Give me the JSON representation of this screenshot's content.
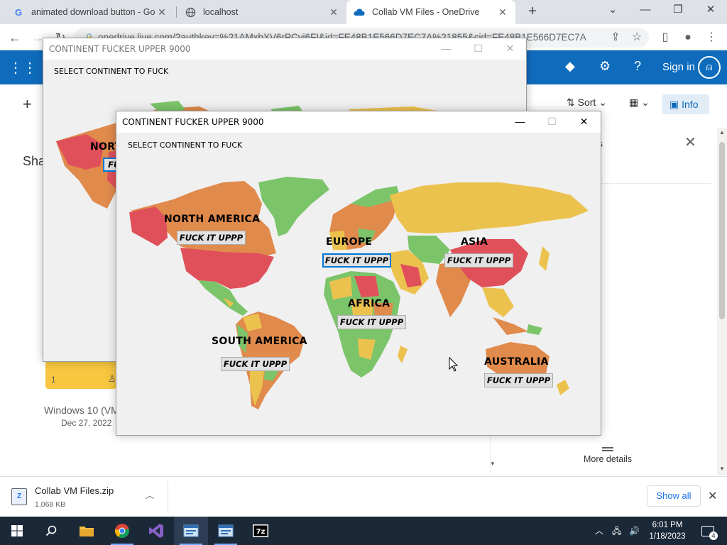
{
  "browser": {
    "tabs": [
      {
        "title": "animated download button - Go",
        "icon": "google-g-icon",
        "active": false
      },
      {
        "title": "localhost",
        "icon": "globe-icon",
        "active": false
      },
      {
        "title": "Collab VM Files - OneDrive",
        "icon": "onedrive-cloud-icon",
        "active": true
      }
    ],
    "url": "onedrive.live.com/?authkey=%21AMxbXV6rPCvi6FI&id=FE48B1E566D7EC7A%21855&cid=FE48B1E566D7EC7A"
  },
  "onedrive": {
    "signin_label": "Sign in",
    "sort_label": "Sort",
    "info_label": "Info",
    "partial_heading": "Sha",
    "partial_pane_text": "s",
    "file_name": "Windows 10 (VM",
    "file_date": "Dec 27, 2022",
    "tile_count": "1",
    "more_details": "More details"
  },
  "app_window": {
    "title": "CONTINENT FUCKER UPPER 9000",
    "prompt": "SELECT CONTINENT TO FUCK",
    "button_label": "FUCK IT UPPP",
    "continents": [
      {
        "name": "NORTH AMERICA"
      },
      {
        "name": "EUROPE",
        "focused": true
      },
      {
        "name": "ASIA"
      },
      {
        "name": "AFRICA"
      },
      {
        "name": "SOUTH AMERICA"
      },
      {
        "name": "AUSTRALIA"
      }
    ],
    "back_partial_label": "NORT",
    "back_partial_button": "FUC"
  },
  "downloads": {
    "file_name": "Collab VM Files.zip",
    "file_size": "1,068 KB",
    "show_all_label": "Show all"
  },
  "taskbar": {
    "time": "6:01 PM",
    "date": "1/18/2023",
    "notification_count": "4"
  },
  "colors": {
    "onedrive_blue": "#0f6cbd",
    "map_red": "#e0505a",
    "map_orange": "#e08a4c",
    "map_yellow": "#ecc24f",
    "map_green": "#7cc46a",
    "ocean": "#f0f0f0",
    "taskbar": "#1b2838"
  }
}
